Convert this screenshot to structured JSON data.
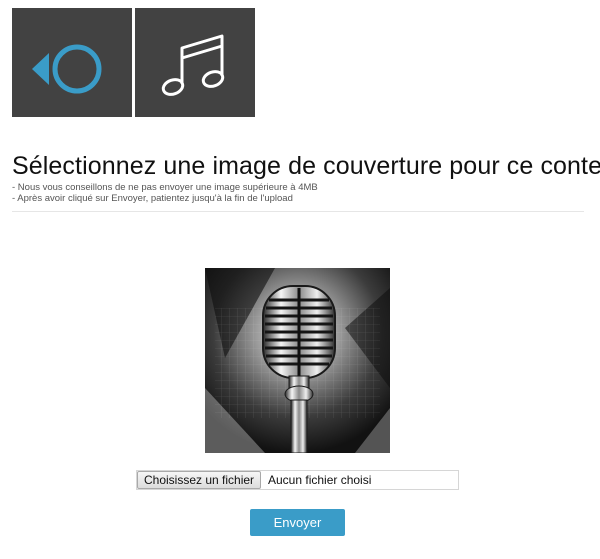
{
  "toolbar": {
    "back_icon": "back-circle-icon",
    "music_icon": "music-note-icon",
    "accent_color": "#3a9cc8",
    "tile_color": "#424242"
  },
  "header": {
    "title": "Sélectionnez une image de couverture pour ce contenu",
    "hints": [
      "- Nous vous conseillons de ne pas envoyer une image supérieure à 4MB",
      "- Après avoir cliqué sur Envoyer, patientez jusqu'à la fin de l'upload"
    ]
  },
  "cover": {
    "image_subject": "microphone-image"
  },
  "upload": {
    "choose_label": "Choisissez un fichier",
    "status": "Aucun fichier choisi",
    "submit_label": "Envoyer"
  }
}
